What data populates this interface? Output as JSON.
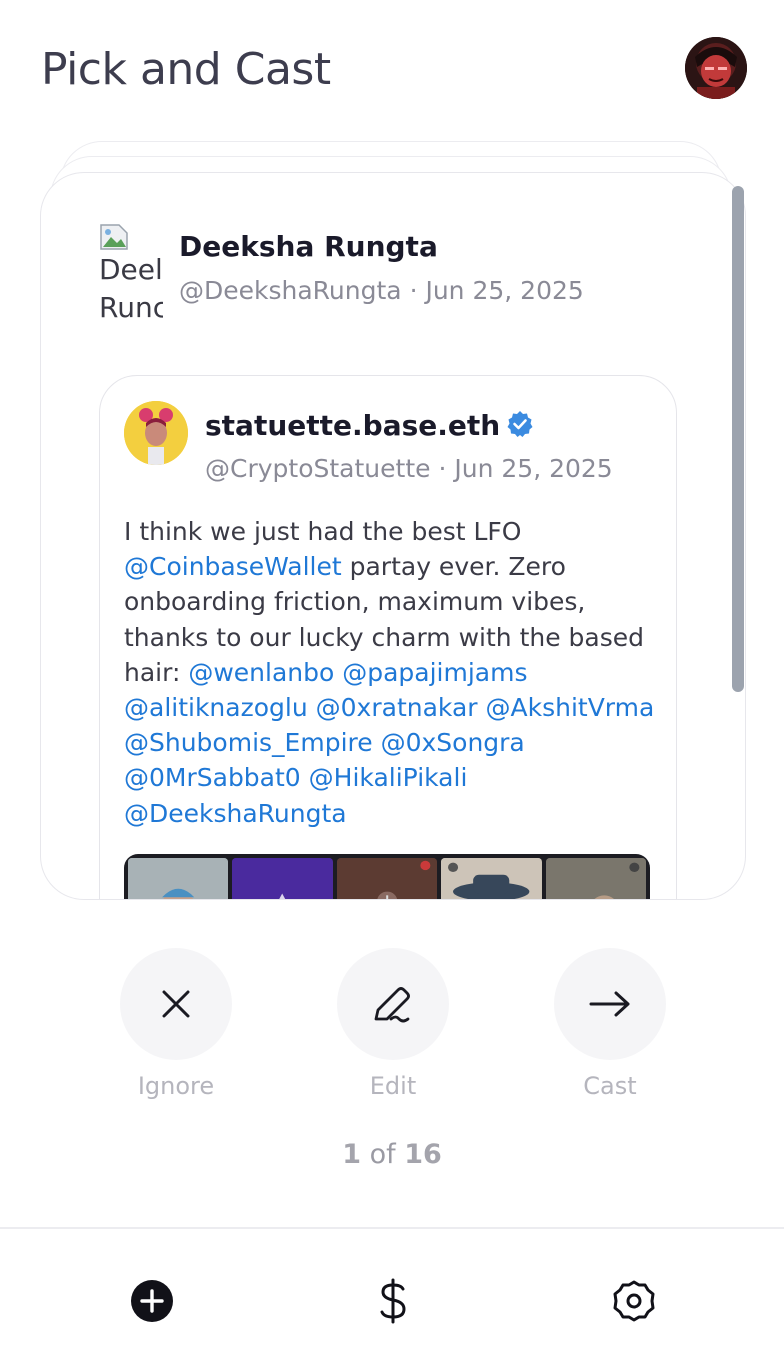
{
  "header": {
    "title": "Pick and Cast"
  },
  "card": {
    "author": {
      "name": "Deeksha Rungta",
      "handle": "@DeekshaRungta",
      "date": "Jun 25, 2025",
      "avatar_alt_line1": "Deel",
      "avatar_alt_line2": "Runc"
    },
    "quote": {
      "name": "statuette.base.eth",
      "handle": "@CryptoStatuette",
      "date": "Jun 25, 2025",
      "text_parts": [
        "I think we just had the best LFO ",
        "@CoinbaseWallet",
        "  partay ever. Zero onboarding friction, maximum vibes, thanks to our lucky charm with the based hair: ",
        "@wenlanbo",
        " ",
        "@papajimjams",
        " ",
        "@alitiknazoglu",
        " ",
        "@0xratnakar",
        " ",
        "@AkshitVrma",
        " ",
        "@Shubomis_Empire",
        " ",
        "@0xSongra",
        " ",
        "@0MrSabbat0",
        " ",
        "@HikaliPikali",
        " ",
        "@DeekshaRungta"
      ]
    }
  },
  "actions": {
    "ignore_label": "Ignore",
    "edit_label": "Edit",
    "cast_label": "Cast"
  },
  "pager": {
    "current": "1",
    "separator": "of",
    "total": "16"
  },
  "colors": {
    "mention": "#1f78d6",
    "verified": "#3b8be0",
    "label": "#b5b5bd"
  },
  "icons": {
    "ignore": "close-icon",
    "edit": "pen-icon",
    "cast": "arrow-right-icon",
    "nav_add": "plus-circle-icon",
    "nav_money": "dollar-icon",
    "nav_settings": "gear-icon"
  }
}
